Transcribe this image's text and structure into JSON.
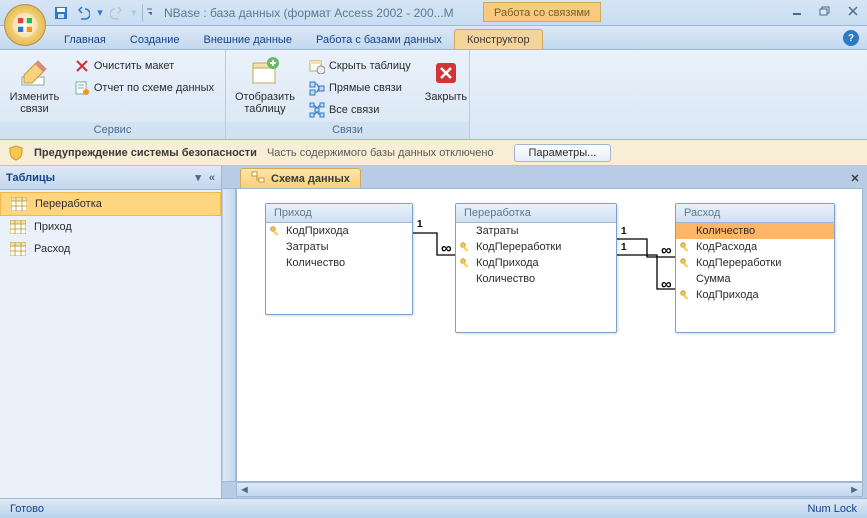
{
  "title": "NBase : база данных (формат Access 2002 - 200...M",
  "contextual_group": "Работа со связями",
  "tabs": [
    "Главная",
    "Создание",
    "Внешние данные",
    "Работа с базами данных",
    "Конструктор"
  ],
  "active_tab": 4,
  "ribbon": {
    "group1": {
      "label": "Сервис",
      "edit": "Изменить\nсвязи",
      "clear": "Очистить макет",
      "report": "Отчет по схеме данных"
    },
    "group2": {
      "label": "Связи",
      "show": "Отобразить\nтаблицу",
      "hide": "Скрыть таблицу",
      "direct": "Прямые связи",
      "all": "Все связи",
      "close": "Закрыть"
    }
  },
  "security": {
    "title": "Предупреждение системы безопасности",
    "msg": "Часть содержимого базы данных отключено",
    "btn": "Параметры..."
  },
  "nav": {
    "title": "Таблицы",
    "items": [
      "Переработка",
      "Приход",
      "Расход"
    ],
    "selected": 0
  },
  "document_tab": "Схема данных",
  "tables": {
    "t1": {
      "title": "Приход",
      "fields": [
        {
          "n": "КодПрихода",
          "k": true
        },
        {
          "n": "Затраты",
          "k": false
        },
        {
          "n": "Количество",
          "k": false
        }
      ]
    },
    "t2": {
      "title": "Переработка",
      "fields": [
        {
          "n": "Затраты",
          "k": false
        },
        {
          "n": "КодПереработки",
          "k": true
        },
        {
          "n": "КодПрихода",
          "k": true
        },
        {
          "n": "Количество",
          "k": false
        }
      ]
    },
    "t3": {
      "title": "Расход",
      "fields": [
        {
          "n": "Количество",
          "k": false,
          "sel": true
        },
        {
          "n": "КодРасхода",
          "k": true
        },
        {
          "n": "КодПереработки",
          "k": true
        },
        {
          "n": "Сумма",
          "k": false
        },
        {
          "n": "КодПрихода",
          "k": true
        }
      ]
    }
  },
  "status": {
    "left": "Готово",
    "right": "Num Lock"
  }
}
